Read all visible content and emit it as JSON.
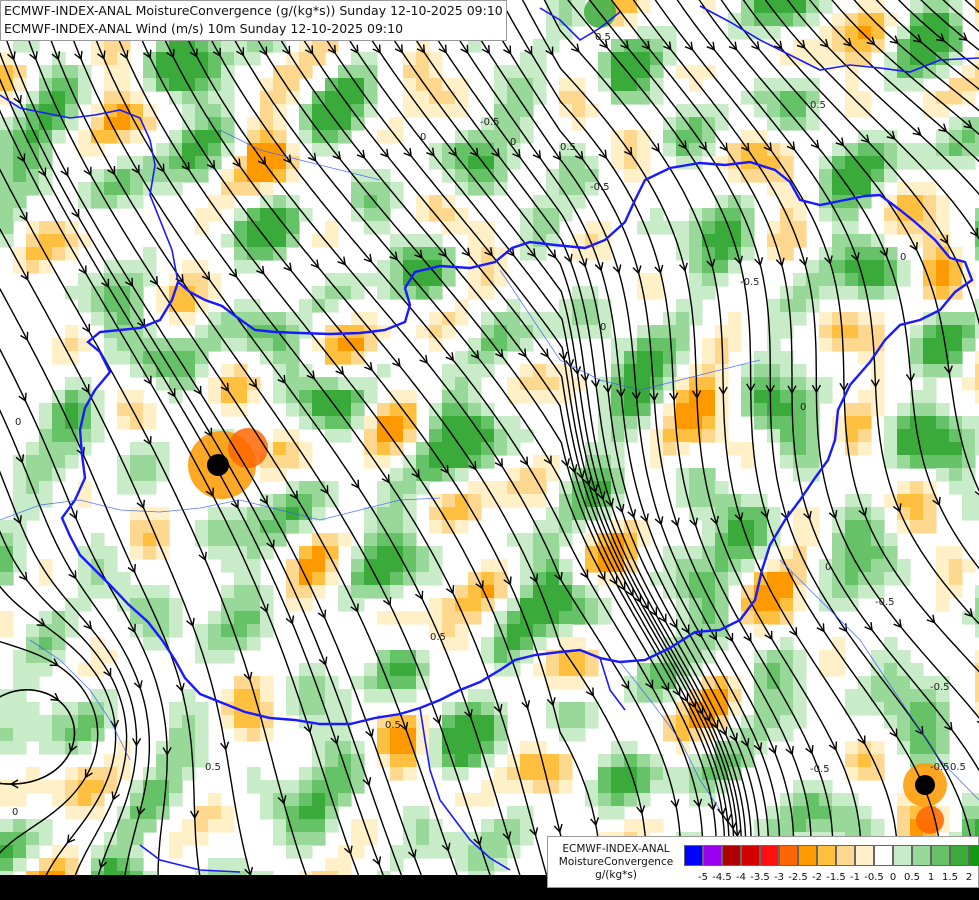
{
  "header": {
    "line1": "ECMWF-INDEX-ANAL MoistureConvergence (g/(kg*s)) Sunday 12-10-2025 09:10",
    "line2": "ECMWF-INDEX-ANAL Wind (m/s) 10m Sunday 12-10-2025 09:10"
  },
  "map_labels": {
    "contour_zero": "0",
    "contour_neg_half": "-0.5",
    "contour_half": "0.5"
  },
  "legend": {
    "line1": "ECMWF-INDEX-ANAL",
    "line2": "MoistureConvergence",
    "unit": "g/(kg*s)",
    "colors": [
      "#0000ff",
      "#9900ee",
      "#b00000",
      "#d40000",
      "#ff1010",
      "#ff6600",
      "#ff9900",
      "#ffc040",
      "#ffd890",
      "#fff0c8",
      "#ffffff",
      "#c8ecc8",
      "#98d898",
      "#66c266",
      "#3aaa3a",
      "#119911"
    ],
    "ticks": [
      "-5",
      "-4.5",
      "-4",
      "-3.5",
      "-3",
      "-2.5",
      "-2",
      "-1.5",
      "-1",
      "-0.5",
      "0",
      "0.5",
      "1",
      "1.5",
      "2"
    ]
  }
}
